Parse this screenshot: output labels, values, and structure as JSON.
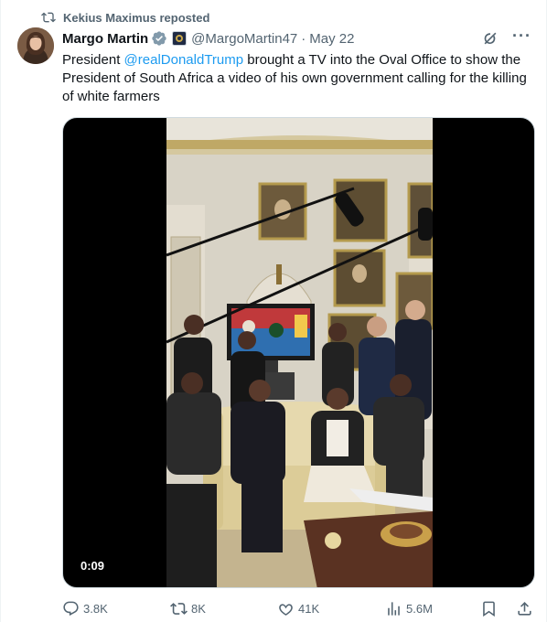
{
  "repost": {
    "icon": "repost-icon",
    "text": "Kekius Maximus reposted"
  },
  "author": {
    "name": "Margo Martin",
    "handle": "@MargoMartin47",
    "separator": "·",
    "date": "May 22",
    "avatar_icon": "avatar"
  },
  "tweet": {
    "text_before": "President ",
    "mention": "@realDonaldTrump",
    "text_after": " brought a TV into the Oval Office to show the President of South Africa a video of his own government calling for the killing of white farmers"
  },
  "media": {
    "type": "video",
    "timestamp": "0:09"
  },
  "actions": {
    "replies": "3.8K",
    "reposts": "8K",
    "likes": "41K",
    "views": "5.6M"
  },
  "colors": {
    "accent": "#1d9bf0",
    "secondary_text": "#536471",
    "primary_text": "#0f1419"
  }
}
